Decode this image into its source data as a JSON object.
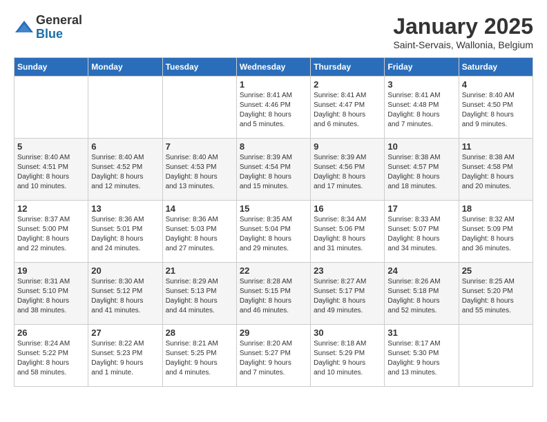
{
  "logo": {
    "general": "General",
    "blue": "Blue"
  },
  "title": "January 2025",
  "subtitle": "Saint-Servais, Wallonia, Belgium",
  "days": [
    "Sunday",
    "Monday",
    "Tuesday",
    "Wednesday",
    "Thursday",
    "Friday",
    "Saturday"
  ],
  "weeks": [
    [
      {
        "day": "",
        "info": ""
      },
      {
        "day": "",
        "info": ""
      },
      {
        "day": "",
        "info": ""
      },
      {
        "day": "1",
        "info": "Sunrise: 8:41 AM\nSunset: 4:46 PM\nDaylight: 8 hours\nand 5 minutes."
      },
      {
        "day": "2",
        "info": "Sunrise: 8:41 AM\nSunset: 4:47 PM\nDaylight: 8 hours\nand 6 minutes."
      },
      {
        "day": "3",
        "info": "Sunrise: 8:41 AM\nSunset: 4:48 PM\nDaylight: 8 hours\nand 7 minutes."
      },
      {
        "day": "4",
        "info": "Sunrise: 8:40 AM\nSunset: 4:50 PM\nDaylight: 8 hours\nand 9 minutes."
      }
    ],
    [
      {
        "day": "5",
        "info": "Sunrise: 8:40 AM\nSunset: 4:51 PM\nDaylight: 8 hours\nand 10 minutes."
      },
      {
        "day": "6",
        "info": "Sunrise: 8:40 AM\nSunset: 4:52 PM\nDaylight: 8 hours\nand 12 minutes."
      },
      {
        "day": "7",
        "info": "Sunrise: 8:40 AM\nSunset: 4:53 PM\nDaylight: 8 hours\nand 13 minutes."
      },
      {
        "day": "8",
        "info": "Sunrise: 8:39 AM\nSunset: 4:54 PM\nDaylight: 8 hours\nand 15 minutes."
      },
      {
        "day": "9",
        "info": "Sunrise: 8:39 AM\nSunset: 4:56 PM\nDaylight: 8 hours\nand 17 minutes."
      },
      {
        "day": "10",
        "info": "Sunrise: 8:38 AM\nSunset: 4:57 PM\nDaylight: 8 hours\nand 18 minutes."
      },
      {
        "day": "11",
        "info": "Sunrise: 8:38 AM\nSunset: 4:58 PM\nDaylight: 8 hours\nand 20 minutes."
      }
    ],
    [
      {
        "day": "12",
        "info": "Sunrise: 8:37 AM\nSunset: 5:00 PM\nDaylight: 8 hours\nand 22 minutes."
      },
      {
        "day": "13",
        "info": "Sunrise: 8:36 AM\nSunset: 5:01 PM\nDaylight: 8 hours\nand 24 minutes."
      },
      {
        "day": "14",
        "info": "Sunrise: 8:36 AM\nSunset: 5:03 PM\nDaylight: 8 hours\nand 27 minutes."
      },
      {
        "day": "15",
        "info": "Sunrise: 8:35 AM\nSunset: 5:04 PM\nDaylight: 8 hours\nand 29 minutes."
      },
      {
        "day": "16",
        "info": "Sunrise: 8:34 AM\nSunset: 5:06 PM\nDaylight: 8 hours\nand 31 minutes."
      },
      {
        "day": "17",
        "info": "Sunrise: 8:33 AM\nSunset: 5:07 PM\nDaylight: 8 hours\nand 34 minutes."
      },
      {
        "day": "18",
        "info": "Sunrise: 8:32 AM\nSunset: 5:09 PM\nDaylight: 8 hours\nand 36 minutes."
      }
    ],
    [
      {
        "day": "19",
        "info": "Sunrise: 8:31 AM\nSunset: 5:10 PM\nDaylight: 8 hours\nand 38 minutes."
      },
      {
        "day": "20",
        "info": "Sunrise: 8:30 AM\nSunset: 5:12 PM\nDaylight: 8 hours\nand 41 minutes."
      },
      {
        "day": "21",
        "info": "Sunrise: 8:29 AM\nSunset: 5:13 PM\nDaylight: 8 hours\nand 44 minutes."
      },
      {
        "day": "22",
        "info": "Sunrise: 8:28 AM\nSunset: 5:15 PM\nDaylight: 8 hours\nand 46 minutes."
      },
      {
        "day": "23",
        "info": "Sunrise: 8:27 AM\nSunset: 5:17 PM\nDaylight: 8 hours\nand 49 minutes."
      },
      {
        "day": "24",
        "info": "Sunrise: 8:26 AM\nSunset: 5:18 PM\nDaylight: 8 hours\nand 52 minutes."
      },
      {
        "day": "25",
        "info": "Sunrise: 8:25 AM\nSunset: 5:20 PM\nDaylight: 8 hours\nand 55 minutes."
      }
    ],
    [
      {
        "day": "26",
        "info": "Sunrise: 8:24 AM\nSunset: 5:22 PM\nDaylight: 8 hours\nand 58 minutes."
      },
      {
        "day": "27",
        "info": "Sunrise: 8:22 AM\nSunset: 5:23 PM\nDaylight: 9 hours\nand 1 minute."
      },
      {
        "day": "28",
        "info": "Sunrise: 8:21 AM\nSunset: 5:25 PM\nDaylight: 9 hours\nand 4 minutes."
      },
      {
        "day": "29",
        "info": "Sunrise: 8:20 AM\nSunset: 5:27 PM\nDaylight: 9 hours\nand 7 minutes."
      },
      {
        "day": "30",
        "info": "Sunrise: 8:18 AM\nSunset: 5:29 PM\nDaylight: 9 hours\nand 10 minutes."
      },
      {
        "day": "31",
        "info": "Sunrise: 8:17 AM\nSunset: 5:30 PM\nDaylight: 9 hours\nand 13 minutes."
      },
      {
        "day": "",
        "info": ""
      }
    ]
  ]
}
